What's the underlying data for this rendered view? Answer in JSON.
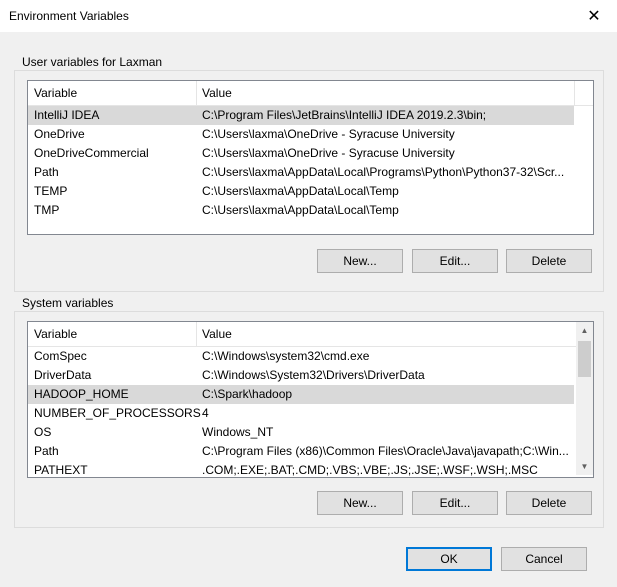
{
  "window": {
    "title": "Environment Variables"
  },
  "user_group": {
    "label": "User variables for Laxman",
    "columns": [
      "Variable",
      "Value"
    ],
    "rows": [
      {
        "variable": "IntelliJ IDEA",
        "value": "C:\\Program Files\\JetBrains\\IntelliJ IDEA 2019.2.3\\bin;",
        "selected": true
      },
      {
        "variable": "OneDrive",
        "value": "C:\\Users\\laxma\\OneDrive - Syracuse University"
      },
      {
        "variable": "OneDriveCommercial",
        "value": "C:\\Users\\laxma\\OneDrive - Syracuse University"
      },
      {
        "variable": "Path",
        "value": "C:\\Users\\laxma\\AppData\\Local\\Programs\\Python\\Python37-32\\Scr..."
      },
      {
        "variable": "TEMP",
        "value": "C:\\Users\\laxma\\AppData\\Local\\Temp"
      },
      {
        "variable": "TMP",
        "value": "C:\\Users\\laxma\\AppData\\Local\\Temp"
      }
    ],
    "buttons": {
      "new": "New...",
      "edit": "Edit...",
      "delete": "Delete"
    }
  },
  "system_group": {
    "label": "System variables",
    "columns": [
      "Variable",
      "Value"
    ],
    "rows": [
      {
        "variable": "ComSpec",
        "value": "C:\\Windows\\system32\\cmd.exe"
      },
      {
        "variable": "DriverData",
        "value": "C:\\Windows\\System32\\Drivers\\DriverData"
      },
      {
        "variable": "HADOOP_HOME",
        "value": "C:\\Spark\\hadoop",
        "selected": true
      },
      {
        "variable": "NUMBER_OF_PROCESSORS",
        "value": "4"
      },
      {
        "variable": "OS",
        "value": "Windows_NT"
      },
      {
        "variable": "Path",
        "value": "C:\\Program Files (x86)\\Common Files\\Oracle\\Java\\javapath;C:\\Win..."
      },
      {
        "variable": "PATHEXT",
        "value": ".COM;.EXE;.BAT;.CMD;.VBS;.VBE;.JS;.JSE;.WSF;.WSH;.MSC"
      }
    ],
    "buttons": {
      "new": "New...",
      "edit": "Edit...",
      "delete": "Delete"
    }
  },
  "footer": {
    "ok": "OK",
    "cancel": "Cancel"
  },
  "icons": {
    "close": "close-icon",
    "scroll_up": "chevron-up-icon",
    "scroll_down": "chevron-down-icon"
  }
}
